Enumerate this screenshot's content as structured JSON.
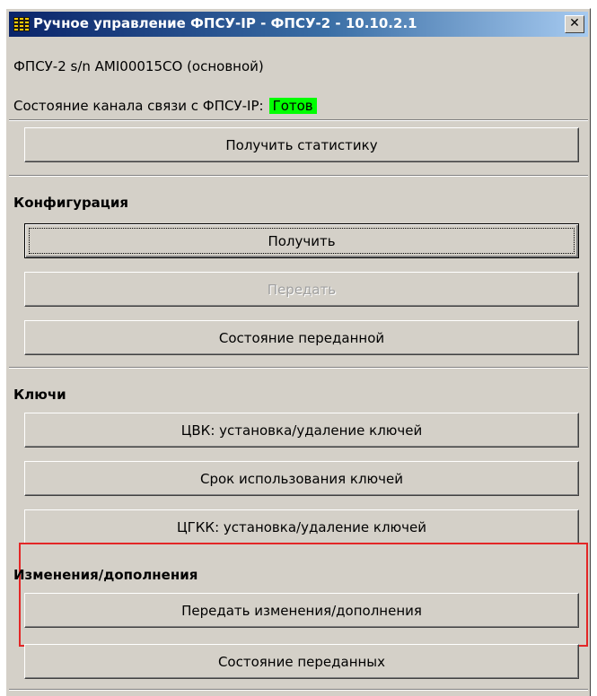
{
  "window": {
    "title": "Ручное управление ФПСУ-IP - ФПСУ-2 - 10.10.2.1",
    "close_glyph": "✕"
  },
  "device": {
    "info": "ФПСУ-2 s/n AMI00015CO (основной)",
    "channel_label": "Состояние канала связи с ФПСУ-IP:",
    "channel_status": "Готов",
    "status_color": "#00ff00"
  },
  "stats": {
    "get_stats_label": "Получить статистику"
  },
  "configuration": {
    "title": "Конфигурация",
    "get_label": "Получить",
    "send_label": "Передать",
    "sent_state_label": "Состояние переданной"
  },
  "keys": {
    "title": "Ключи",
    "cvk_label": "ЦВК: установка/удаление ключей",
    "usage_period_label": "Срок использования ключей",
    "cgkk_label": "ЦГКК: установка/удаление ключей"
  },
  "changes": {
    "title": "Изменения/дополнения",
    "send_changes_label": "Передать изменения/дополнения",
    "sent_state_label": "Состояние переданных",
    "highlight_color": "#e32626"
  },
  "icons": {
    "app_icon": "app-grid-icon",
    "close_icon": "close-icon"
  }
}
